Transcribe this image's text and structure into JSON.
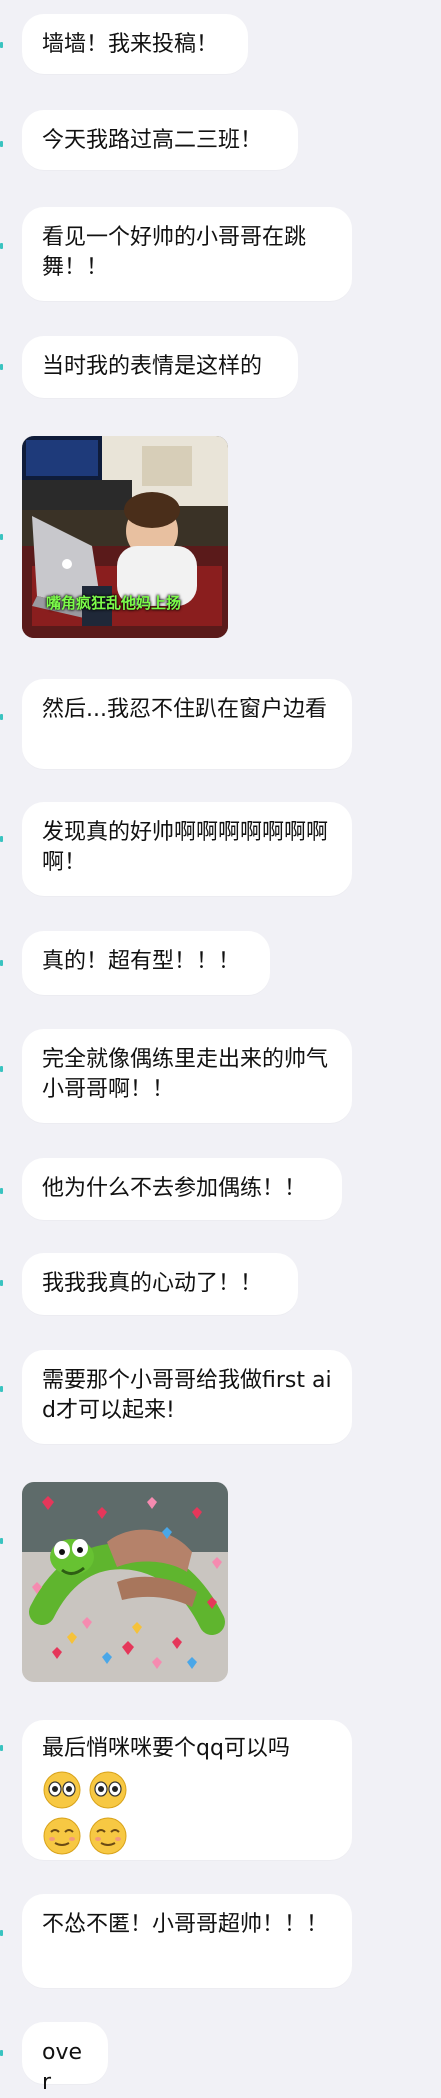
{
  "messages": [
    {
      "text": "墙墙！我来投稿！"
    },
    {
      "text": "今天我路过高二三班！"
    },
    {
      "text": "看见一个好帅的小哥哥在跳舞！！"
    },
    {
      "text": "当时我的表情是这样的"
    },
    {
      "image": "child-at-laptop",
      "caption": "嘴角疯狂乱他妈上扬"
    },
    {
      "text": "然后...我忍不住趴在窗户边看"
    },
    {
      "text": "发现真的好帅啊啊啊啊啊啊啊啊！"
    },
    {
      "text": "真的！超有型！！！"
    },
    {
      "text": "完全就像偶练里走出来的帅气小哥哥啊！！"
    },
    {
      "text": "他为什么不去参加偶练！！"
    },
    {
      "text": "我我我真的心动了！！"
    },
    {
      "text": "需要那个小哥哥给我做first aid才可以起来!"
    },
    {
      "image": "kermit-hearts"
    },
    {
      "text": "最后悄咪咪要个qq可以吗",
      "emojis": [
        "eyes",
        "eyes",
        "smile",
        "smile"
      ]
    },
    {
      "text": "不怂不匿！小哥哥超帅！！！"
    },
    {
      "text": "over"
    }
  ],
  "colors": {
    "background": "#f1f1f6",
    "bubble": "#ffffff",
    "edge_tick": "#39c3c0",
    "caption": "#7CFC4A"
  }
}
